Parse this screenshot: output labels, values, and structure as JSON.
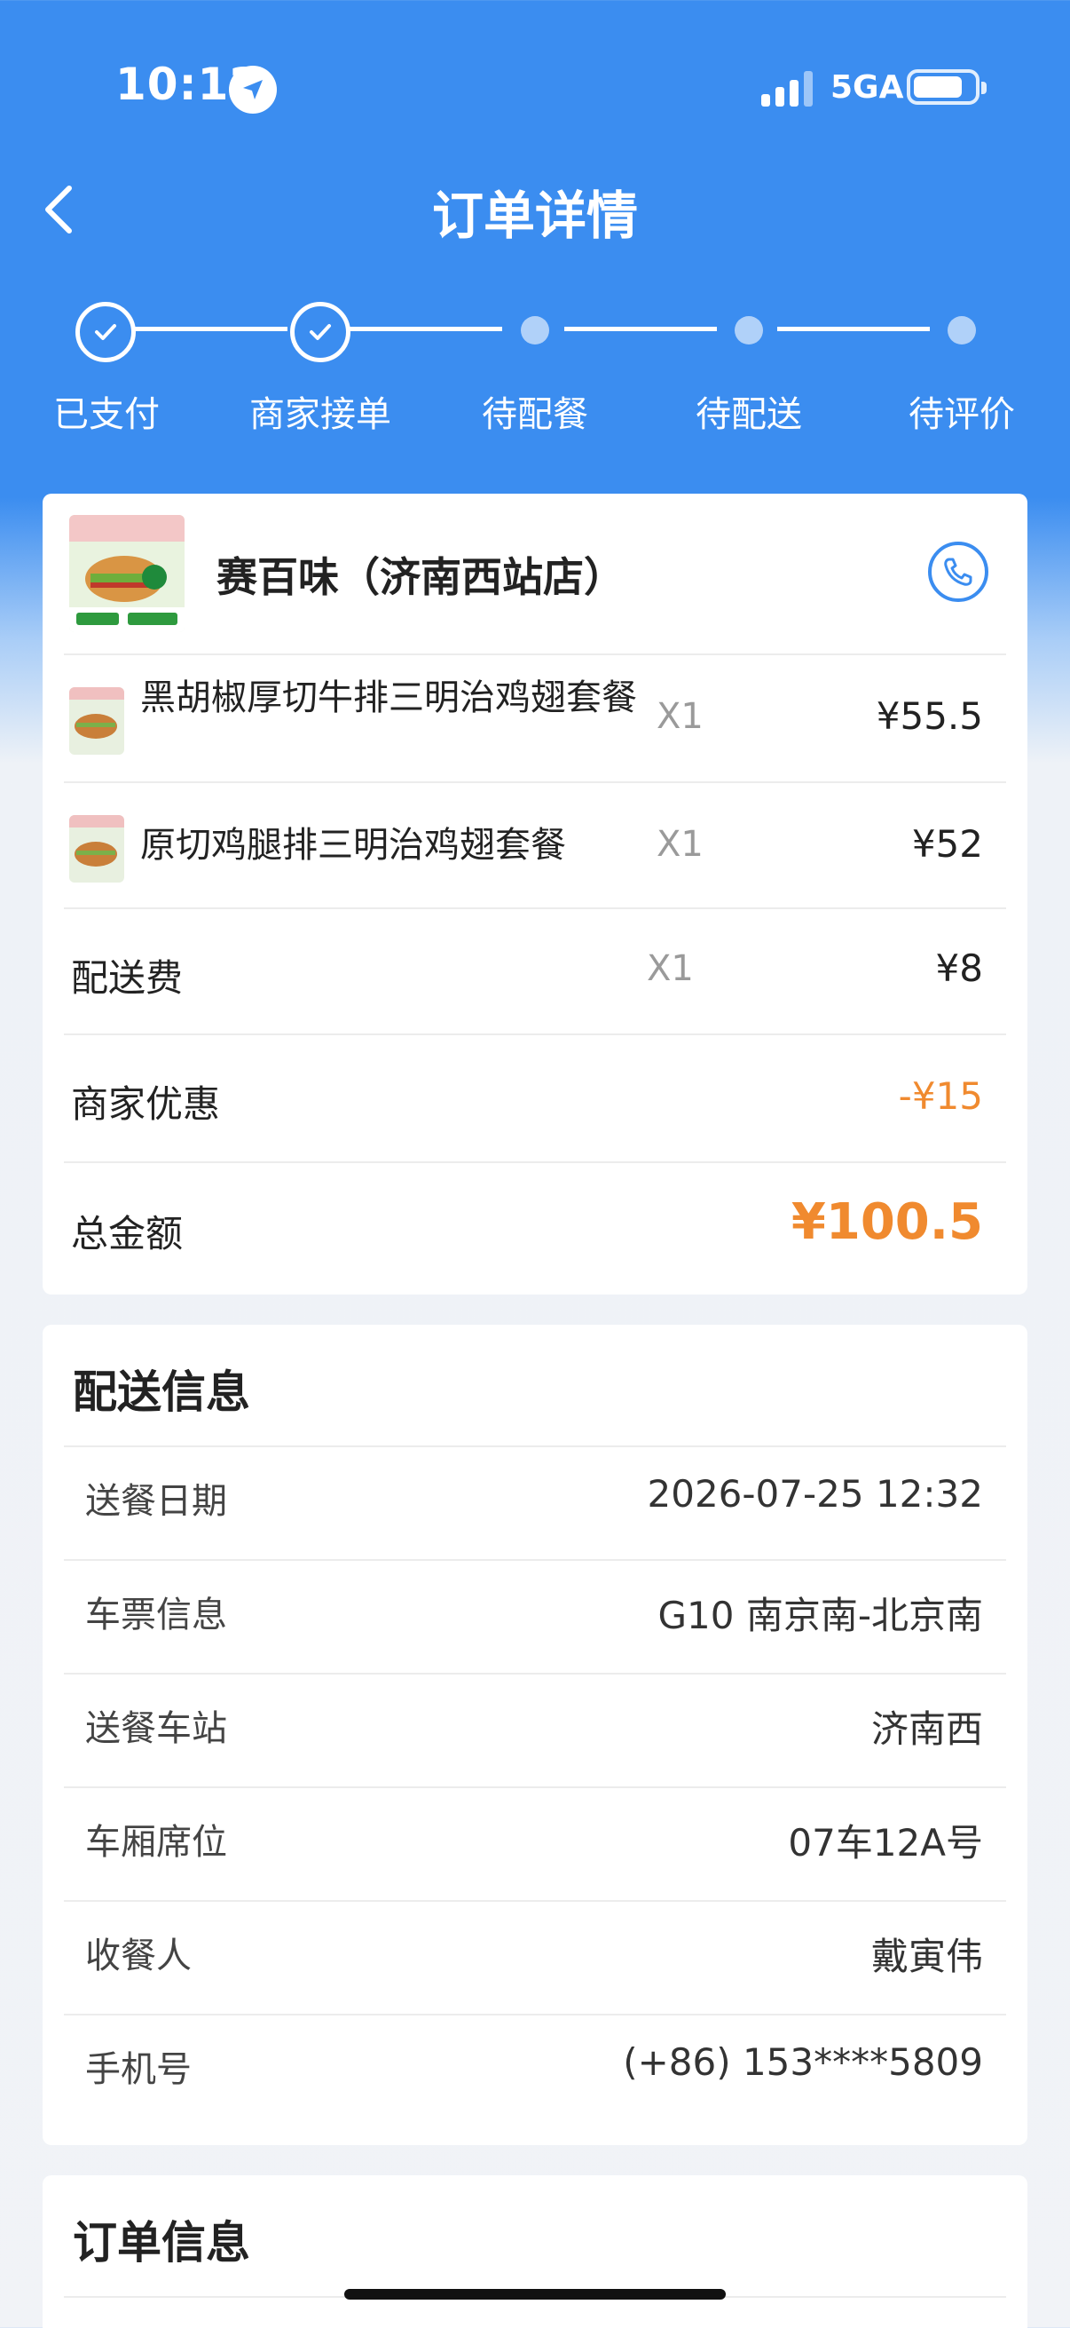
{
  "status_bar": {
    "time": "10:12",
    "network": "5GA"
  },
  "header": {
    "title": "订单详情"
  },
  "steps": [
    {
      "label": "已支付",
      "done": true
    },
    {
      "label": "商家接单",
      "done": true
    },
    {
      "label": "待配餐",
      "done": false
    },
    {
      "label": "待配送",
      "done": false
    },
    {
      "label": "待评价",
      "done": false
    }
  ],
  "order": {
    "shop_name": "赛百味（济南西站店）",
    "items": [
      {
        "name": "黑胡椒厚切牛排三明治鸡翅套餐",
        "qty": "X1",
        "price": "¥55.5"
      },
      {
        "name": "原切鸡腿排三明治鸡翅套餐",
        "qty": "X1",
        "price": "¥52"
      }
    ],
    "delivery_fee": {
      "label": "配送费",
      "qty": "X1",
      "price": "¥8"
    },
    "merchant_discount": {
      "label": "商家优惠",
      "value": "-¥15"
    },
    "total": {
      "label": "总金额",
      "value": "¥100.5"
    }
  },
  "delivery_info": {
    "title": "配送信息",
    "rows": [
      {
        "label": "送餐日期",
        "value": "2026-07-25 12:32"
      },
      {
        "label": "车票信息",
        "value": "G10 南京南-北京南"
      },
      {
        "label": "送餐车站",
        "value": "济南西"
      },
      {
        "label": "车厢席位",
        "value": "07车12A号"
      },
      {
        "label": "收餐人",
        "value": "戴寅伟"
      },
      {
        "label": "手机号",
        "value": "(+86) 153****5809"
      }
    ]
  },
  "order_info": {
    "title": "订单信息"
  },
  "colors": {
    "primary": "#3b8df0",
    "accent": "#f08a2f"
  }
}
